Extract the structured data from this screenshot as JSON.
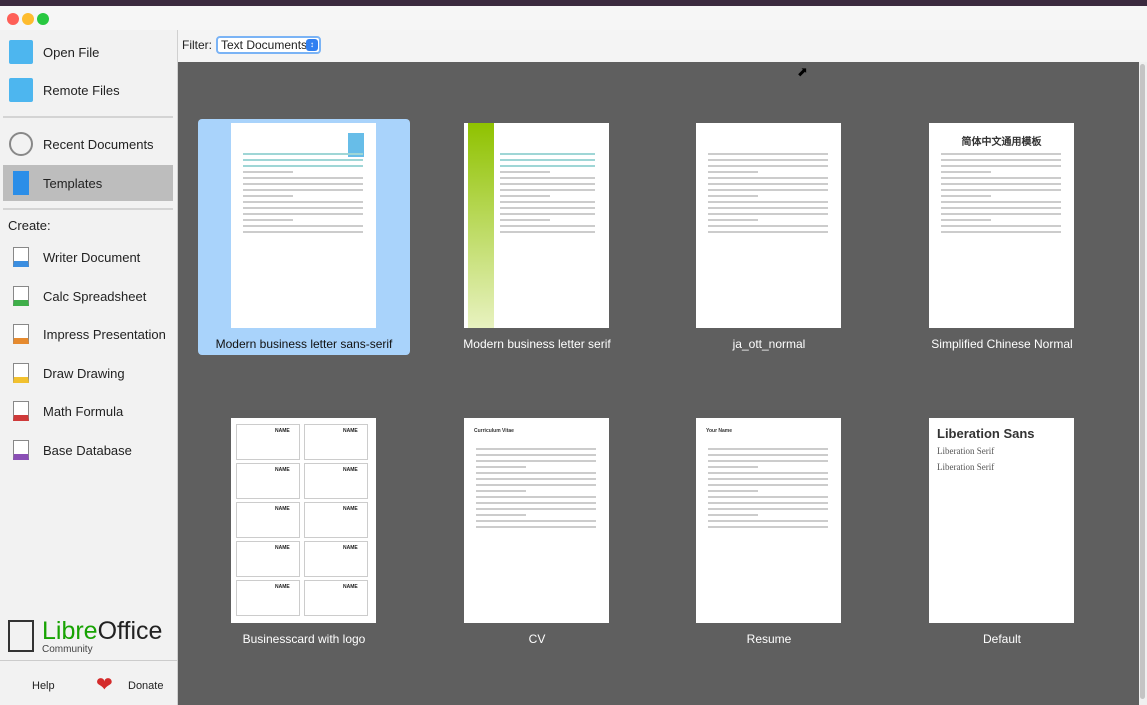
{
  "sidebar": {
    "open_file": "Open File",
    "remote_files": "Remote Files",
    "recent_documents": "Recent Documents",
    "templates": "Templates",
    "create_label": "Create:",
    "create_items": [
      {
        "label": "Writer Document",
        "color": "#3b8ee0"
      },
      {
        "label": "Calc Spreadsheet",
        "color": "#3fae49"
      },
      {
        "label": "Impress Presentation",
        "color": "#e68a2e"
      },
      {
        "label": "Draw Drawing",
        "color": "#f2c12e"
      },
      {
        "label": "Math Formula",
        "color": "#cf3a3a"
      },
      {
        "label": "Base Database",
        "color": "#8a4fb5"
      }
    ],
    "logo": {
      "libre": "Libre",
      "office": "Office",
      "community": "Community"
    },
    "help": "Help",
    "donate": "Donate"
  },
  "filter": {
    "label": "Filter:",
    "value": "Text Documents"
  },
  "templates": [
    {
      "name": "Modern business letter sans-serif",
      "selected": true
    },
    {
      "name": "Modern business letter serif"
    },
    {
      "name": "ja_ott_normal"
    },
    {
      "name": "Simplified Chinese Normal",
      "heading": "简体中文通用模板"
    },
    {
      "name": "Businesscard with logo"
    },
    {
      "name": "CV",
      "heading": "Curriculum Vitae"
    },
    {
      "name": "Resume",
      "heading": "Your Name"
    },
    {
      "name": "Default",
      "heading": "Liberation Sans",
      "lines": [
        "Liberation Serif",
        "Liberation Serif"
      ]
    }
  ],
  "colors": {
    "accent": "#a9d3fb",
    "libre_green": "#18a303",
    "main_bg": "#5f5f5f"
  }
}
